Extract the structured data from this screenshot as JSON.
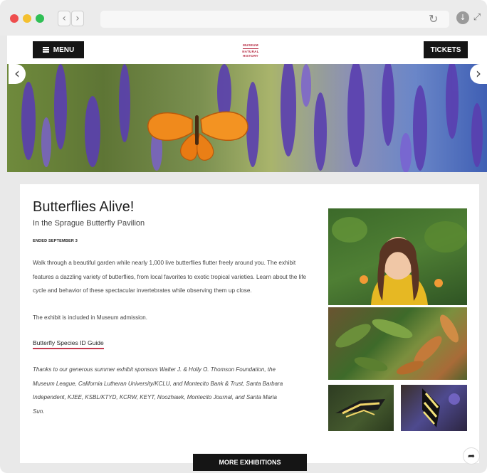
{
  "browser": {
    "back_icon": "‹",
    "forward_icon": "›",
    "reload_icon": "↻",
    "download_icon": "↓",
    "resize_icon": "⤢"
  },
  "header": {
    "menu_label": "MENU",
    "tickets_label": "TICKETS",
    "logo_lines": [
      "MUSEUM",
      "NATURAL",
      "HISTORY"
    ]
  },
  "hero": {
    "prev_icon": "‹",
    "next_icon": "›"
  },
  "exhibit": {
    "title": "Butterflies Alive!",
    "subtitle": "In the Sprague Butterfly Pavilion",
    "date": "ENDED SEPTEMBER 3",
    "body": "Walk through a beautiful garden while nearly 1,000 live butterflies flutter freely around you. The exhibit features a dazzling variety of butterflies, from local favorites to exotic tropical varieties. Learn about the life cycle and behavior of these spectacular invertebrates while observing them up close.",
    "included": "The exhibit is included in Museum admission.",
    "guide_link": "Butterfly Species ID Guide",
    "thanks": "Thanks to our generous summer exhibit sponsors Walter J. & Holly O. Thomson Foundation, the Museum League, California Lutheran University/KCLU, and Montecito Bank & Trust, Santa Barbara Independent, KJEE, KSBL/KTYD, KCRW, KEYT, Noozhawk, Montecito Journal, and Santa Maria Sun."
  },
  "footer": {
    "more_label": "MORE EXHIBITIONS",
    "share_icon": "➦"
  },
  "colors": {
    "accent": "#c33a4f",
    "button_bg": "#151515"
  }
}
